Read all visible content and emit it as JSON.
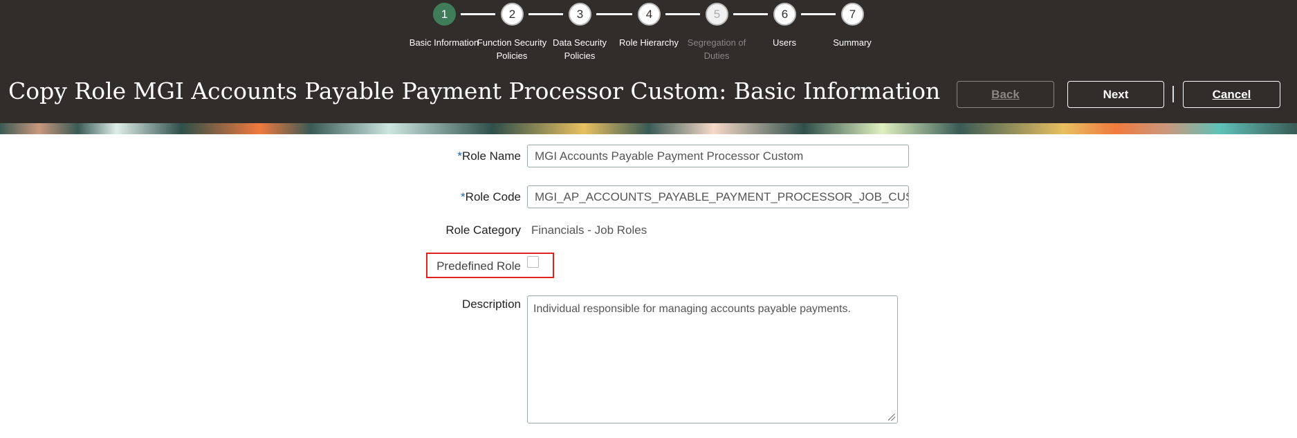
{
  "train": {
    "steps": [
      {
        "number": "1",
        "label": "Basic Information",
        "state": "active"
      },
      {
        "number": "2",
        "label": "Function Security Policies",
        "state": "normal"
      },
      {
        "number": "3",
        "label": "Data Security Policies",
        "state": "normal"
      },
      {
        "number": "4",
        "label": "Role Hierarchy",
        "state": "normal"
      },
      {
        "number": "5",
        "label": "Segregation of Duties",
        "state": "disabled"
      },
      {
        "number": "6",
        "label": "Users",
        "state": "normal"
      },
      {
        "number": "7",
        "label": "Summary",
        "state": "normal"
      }
    ]
  },
  "header": {
    "title": "Copy Role MGI Accounts Payable Payment Processor Custom: Basic Information",
    "back_label": "Back",
    "next_label": "Next",
    "cancel_label": "Cancel"
  },
  "form": {
    "required_mark": "*",
    "role_name_label": "Role Name",
    "role_name_value": "MGI Accounts Payable Payment Processor Custom",
    "role_code_label": "Role Code",
    "role_code_value": "MGI_AP_ACCOUNTS_PAYABLE_PAYMENT_PROCESSOR_JOB_CUSTOM_CUSTOM",
    "role_category_label": "Role Category",
    "role_category_value": "Financials - Job Roles",
    "predefined_role_label": "Predefined Role",
    "predefined_role_checked": false,
    "description_label": "Description",
    "description_value": "Individual responsible for managing accounts payable payments."
  },
  "colors": {
    "header_bg": "#312d2a",
    "active_step": "#3f7c5a",
    "highlight": "#e02020",
    "required": "#1f5fa6"
  }
}
